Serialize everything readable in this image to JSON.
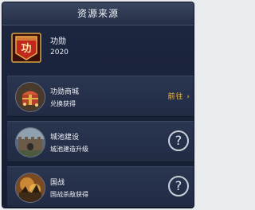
{
  "header": {
    "title": "资源来源"
  },
  "summary": {
    "icon": "merit-medal-icon",
    "name": "功勋",
    "value": "2020",
    "icon_glyph": "功"
  },
  "sources": [
    {
      "title": "功勋商城",
      "subtitle": "兑换获得",
      "icon": "treasure-chest-icon",
      "action": "goto",
      "action_label": "前往",
      "action_arrow": "›"
    },
    {
      "title": "城池建设",
      "subtitle": "城池建造升级",
      "icon": "city-wall-icon",
      "action": "help",
      "action_label": "?"
    },
    {
      "title": "国战",
      "subtitle": "国战杀敌获得",
      "icon": "battle-icon",
      "action": "help",
      "action_label": "?"
    }
  ],
  "colors": {
    "accent": "#f5c04a",
    "panel": "#1d2740",
    "row": "#2a3550",
    "medal_red": "#c0281e",
    "medal_gold": "#e1b04a"
  }
}
